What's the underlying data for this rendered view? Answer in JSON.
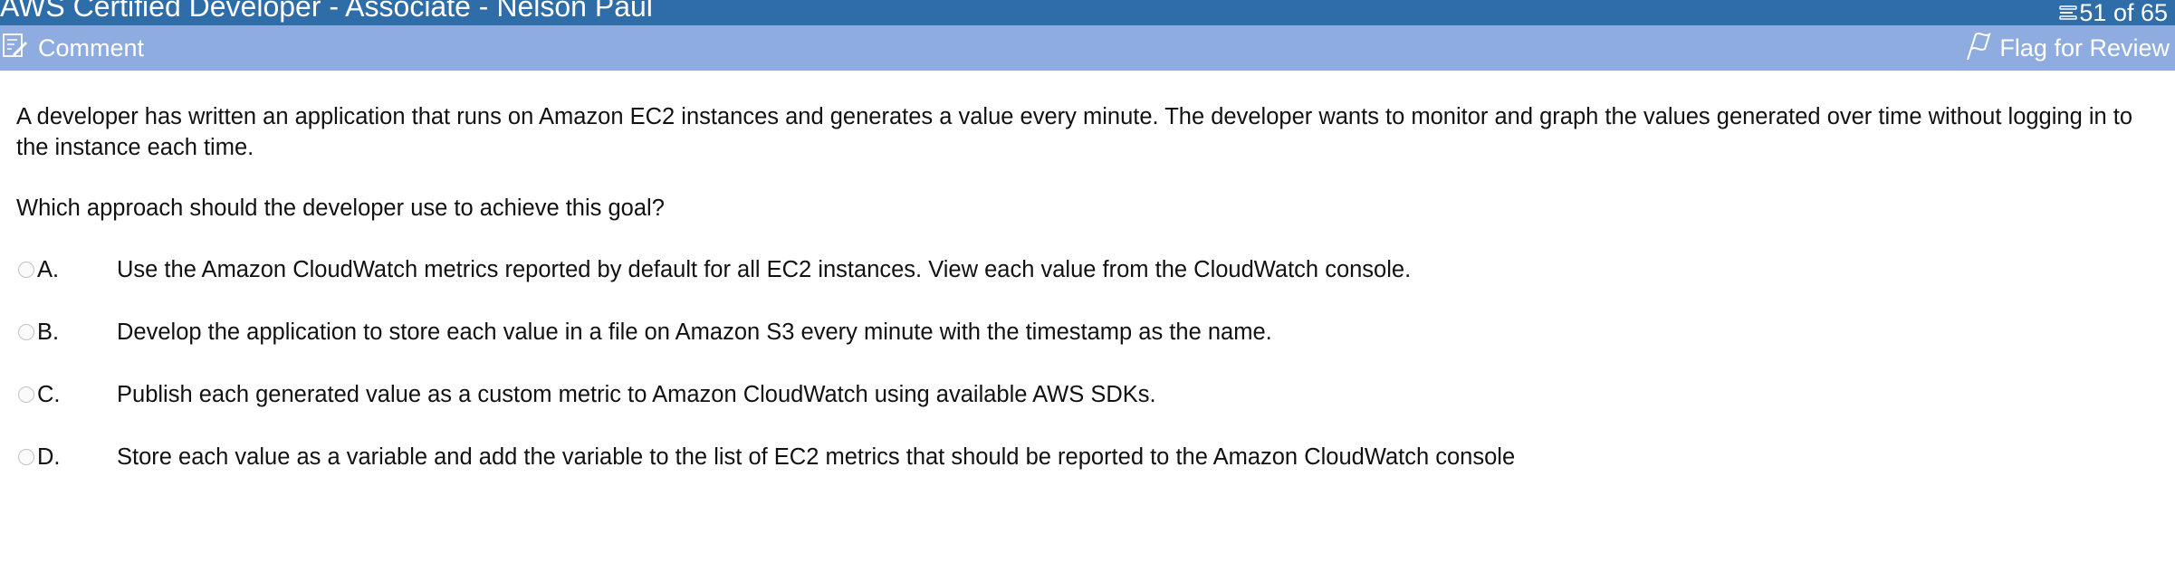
{
  "header": {
    "title": "AWS Certified Developer - Associate - Nelson Paul",
    "counter": "51 of 65"
  },
  "toolbar": {
    "comment_label": "Comment",
    "flag_label": "Flag for Review"
  },
  "question": {
    "text": "A developer has written an application that runs on Amazon EC2 instances and generates a value every minute. The developer wants to monitor and graph the values generated over time without logging in to the instance each time.",
    "prompt": "Which approach should the developer use to achieve this goal?",
    "options": [
      {
        "letter": "A.",
        "text": "Use the Amazon CloudWatch metrics reported by default for all EC2 instances. View each value from the CloudWatch console."
      },
      {
        "letter": "B.",
        "text": "Develop the application to store each value in a file on Amazon S3 every minute with the timestamp as the name."
      },
      {
        "letter": "C.",
        "text": "Publish each generated value as a custom metric to Amazon CloudWatch using available AWS SDKs."
      },
      {
        "letter": "D.",
        "text": "Store each value as a variable and add the variable to the list of EC2 metrics that should be reported to the Amazon CloudWatch console"
      }
    ]
  },
  "icons": {
    "comment": "comment-edit-icon",
    "counter": "list-icon",
    "flag": "flag-icon"
  },
  "colors": {
    "titlebar": "#2e6da8",
    "toolbar": "#8eacdf"
  }
}
